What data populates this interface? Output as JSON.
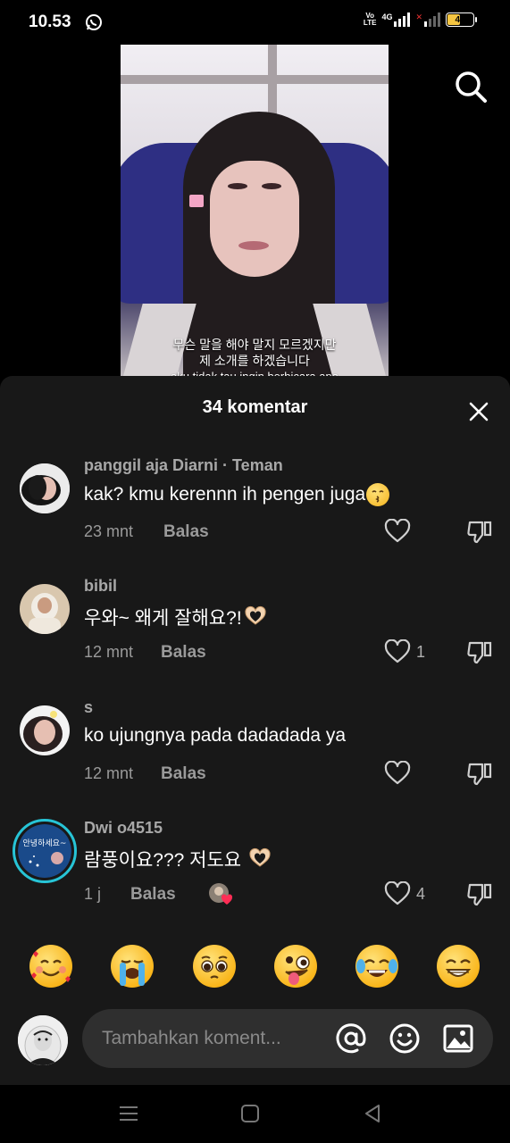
{
  "status_bar": {
    "time": "10.53",
    "volte_top": "Vo",
    "volte_bottom": "LTE",
    "network": "4G",
    "battery": "48"
  },
  "video": {
    "subtitle_line1": "무슨 말을 해야 말지 모르겠지만",
    "subtitle_line2": "제 소개를 하겠습니다",
    "subtitle_line3": "aku tidak tau ingin berbicara apa"
  },
  "comments_sheet": {
    "title": "34 komentar",
    "comments": [
      {
        "username": "panggil aja Diarni · Teman",
        "text": "kak? kmu kerennn ih pengen juga",
        "emoji": "kissing-face",
        "time": "23 mnt",
        "reply_label": "Balas",
        "likes": ""
      },
      {
        "username": "bibil",
        "text": "우와~ 왜게 잘해요?!",
        "emoji": "heart-hands",
        "time": "12 mnt",
        "reply_label": "Balas",
        "likes": "1"
      },
      {
        "username": "s",
        "text": "ko ujungnya pada dadadada ya",
        "emoji": "",
        "time": "12 mnt",
        "reply_label": "Balas",
        "likes": ""
      },
      {
        "username": "Dwi o4515",
        "text": "람풍이요??? 저도요",
        "emoji": "heart-hands",
        "time": "1 j",
        "reply_label": "Balas",
        "likes": "4",
        "avatar_text": "안녕하세요~"
      }
    ]
  },
  "quick_emojis": [
    "smiling-face-with-hearts",
    "loudly-crying-face",
    "pleading-face",
    "zany-face",
    "face-with-tears-of-joy",
    "beaming-face"
  ],
  "input": {
    "placeholder": "Tambahkan koment..."
  },
  "colors": {
    "sheet_bg": "#181818",
    "input_bg": "#2f2f2f",
    "muted_text": "#9a9a9a",
    "story_ring": "#27c4d6"
  }
}
